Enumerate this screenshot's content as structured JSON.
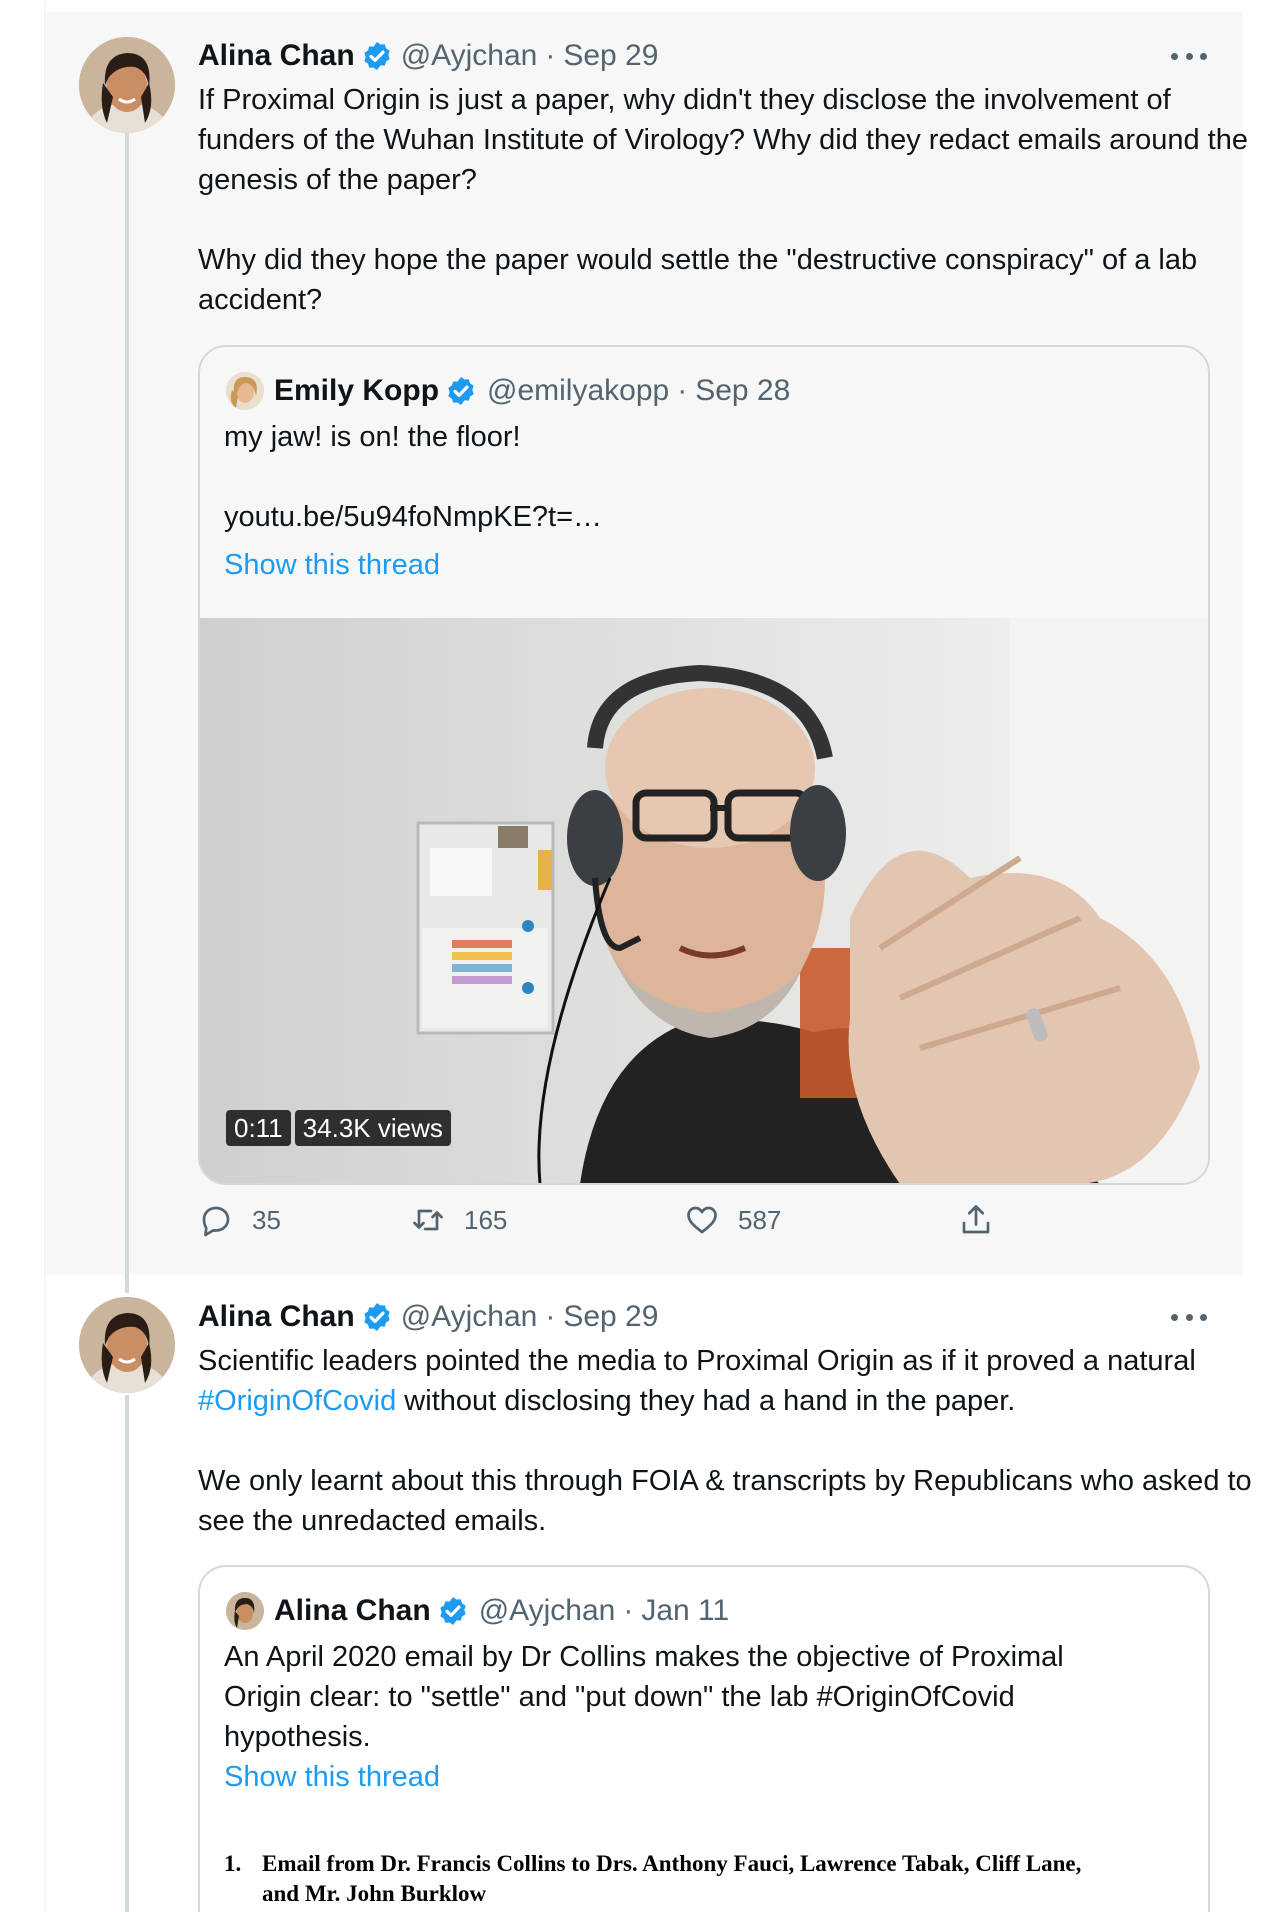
{
  "tweet1": {
    "author": {
      "name": "Alina Chan",
      "handle": "@Ayjchan",
      "separator": "·",
      "date": "Sep 29"
    },
    "text": "If Proximal Origin is just a paper, why didn't they disclose the involvement of funders of the Wuhan Institute of Virology? Why did they redact emails around the genesis of the paper?\n\nWhy did they hope the paper would settle the \"destructive conspiracy\" of a lab accident?",
    "quote": {
      "author": {
        "name": "Emily Kopp",
        "handle": "@emilyakopp",
        "separator": "·",
        "date": "Sep 28"
      },
      "text": "my jaw! is on! the floor!",
      "link": "youtu.be/5u94foNmpKE?t=…",
      "show_thread": "Show this thread",
      "video": {
        "duration": "0:11",
        "views": "34.3K views"
      }
    },
    "actions": {
      "replies": "35",
      "retweets": "165",
      "likes": "587"
    }
  },
  "tweet2": {
    "author": {
      "name": "Alina Chan",
      "handle": "@Ayjchan",
      "separator": "·",
      "date": "Sep 29"
    },
    "text_before": "Scientific leaders pointed the media to Proximal Origin as if it proved a natural ",
    "hashtag": "#OriginOfCovid",
    "text_after": " without disclosing they had a hand in the paper.\n\nWe only learnt about this through FOIA & transcripts by Republicans who asked to see the unredacted emails.",
    "quote": {
      "author": {
        "name": "Alina Chan",
        "handle": "@Ayjchan",
        "separator": "·",
        "date": "Jan 11"
      },
      "text": "An April 2020 email by Dr Collins makes the objective of Proximal Origin clear: to \"settle\" and \"put down\" the lab #OriginOfCovid hypothesis.",
      "show_thread": "Show this thread",
      "document": {
        "number": "1.",
        "line1": "Email from Dr. Francis Collins to Drs. Anthony Fauci, Lawrence Tabak, Cliff Lane,",
        "line2": "and Mr. John Burklow"
      }
    }
  },
  "colors": {
    "link": "#1d9bf0",
    "verified": "#1d9bf0",
    "muted": "#536471",
    "thread_line": "#cfd9de"
  },
  "icons": [
    "verified-badge-icon",
    "more-options-icon",
    "reply-icon",
    "retweet-icon",
    "like-icon",
    "share-icon"
  ]
}
